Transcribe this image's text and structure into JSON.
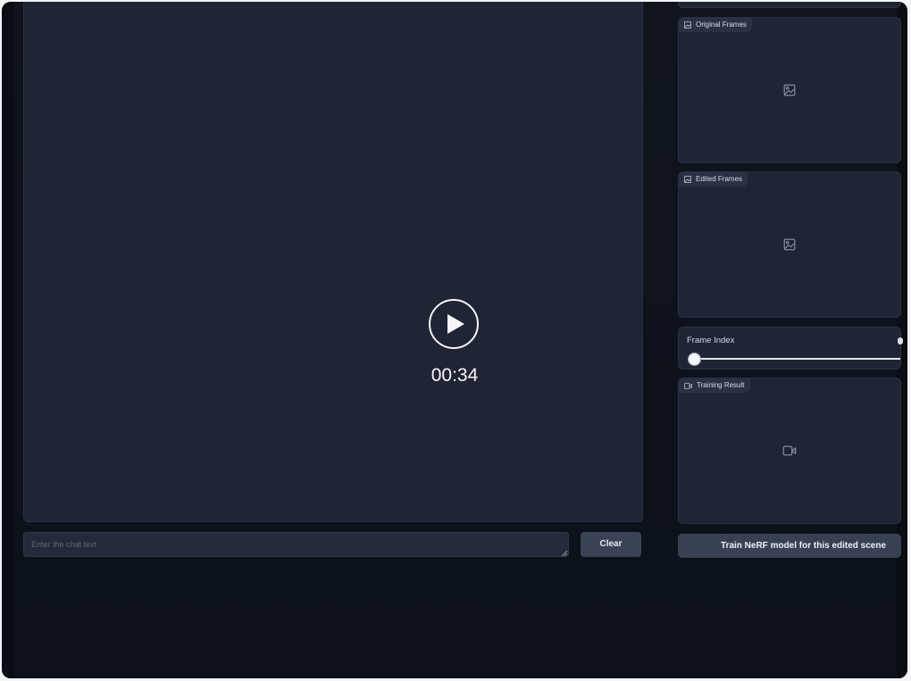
{
  "video": {
    "timecode": "00:34"
  },
  "chat": {
    "placeholder": "Enter the chat text",
    "clear_label": "Clear"
  },
  "panels": {
    "original_frames": {
      "label": "Original Frames"
    },
    "edited_frames": {
      "label": "Edited Frames"
    },
    "frame_index": {
      "label": "Frame Index",
      "value": 0
    },
    "training_result": {
      "label": "Training Result"
    }
  },
  "train_button": {
    "label": "Train NeRF model for this edited scene"
  },
  "icons": {
    "play": "play-icon",
    "image": "image-icon",
    "video": "video-camera-icon"
  },
  "colors": {
    "panel": "#1f2535",
    "background": "#0f141d",
    "button": "#3a4255"
  }
}
